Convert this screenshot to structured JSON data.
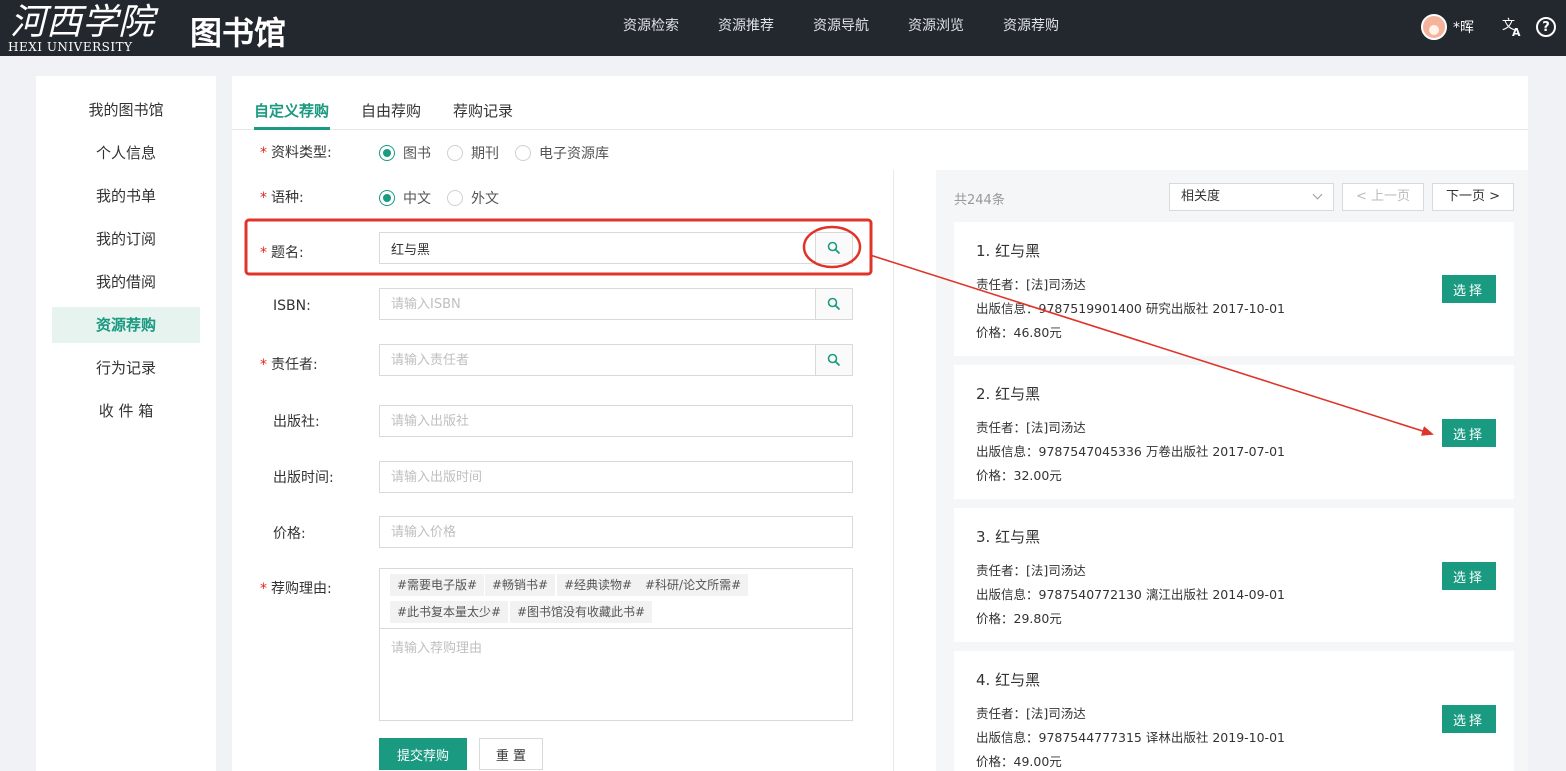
{
  "header": {
    "logo_calligraphy": "河西学院",
    "logo_en": "HEXI UNIVERSITY",
    "logo_lib": "图书馆",
    "nav": [
      "资源检索",
      "资源推荐",
      "资源导航",
      "资源浏览",
      "资源荐购"
    ],
    "username": "*晖",
    "lang_icon": "translate-icon",
    "help_icon": "help-icon"
  },
  "sidebar": {
    "items": [
      "我的图书馆",
      "个人信息",
      "我的书单",
      "我的订阅",
      "我的借阅",
      "资源荐购",
      "行为记录",
      "收 件 箱"
    ],
    "active": 5
  },
  "tabs": {
    "items": [
      "自定义荐购",
      "自由荐购",
      "荐购记录"
    ],
    "active": 0
  },
  "form": {
    "type": {
      "label": "资料类型:",
      "options": [
        "图书",
        "期刊",
        "电子资源库"
      ],
      "selected": 0
    },
    "language": {
      "label": "语种:",
      "options": [
        "中文",
        "外文"
      ],
      "selected": 0
    },
    "title": {
      "label": "题名:",
      "value": "红与黑"
    },
    "isbn": {
      "label": "ISBN:",
      "placeholder": "请输入ISBN"
    },
    "author": {
      "label": "责任者:",
      "placeholder": "请输入责任者"
    },
    "publisher": {
      "label": "出版社:",
      "placeholder": "请输入出版社"
    },
    "pubdate": {
      "label": "出版时间:",
      "placeholder": "请输入出版时间"
    },
    "price": {
      "label": "价格:",
      "placeholder": "请输入价格"
    },
    "reason": {
      "label": "荐购理由:",
      "tags": [
        "#需要电子版#",
        "#畅销书#",
        "#经典读物#",
        "#科研/论文所需#",
        "#此书复本量太少#",
        "#图书馆没有收藏此书#"
      ],
      "placeholder": "请输入荐购理由"
    },
    "submit_label": "提交荐购",
    "reset_label": "重 置"
  },
  "results": {
    "total": "共244条",
    "sort": "相关度",
    "prev": "上一页",
    "next": "下一页",
    "select_label": "选择",
    "items": [
      {
        "title": "1. 红与黑",
        "author": "责任者：[法]司汤达",
        "pub": "出版信息：9787519901400  研究出版社  2017-10-01",
        "price": "价格：46.80元"
      },
      {
        "title": "2. 红与黑",
        "author": "责任者：[法]司汤达",
        "pub": "出版信息：9787547045336  万卷出版社  2017-07-01",
        "price": "价格：32.00元"
      },
      {
        "title": "3. 红与黑",
        "author": "责任者：[法]司汤达",
        "pub": "出版信息：9787540772130  漓江出版社  2014-09-01",
        "price": "价格：29.80元"
      },
      {
        "title": "4. 红与黑",
        "author": "责任者：[法]司汤达",
        "pub": "出版信息：9787544777315  译林出版社  2019-10-01",
        "price": "价格：49.00元"
      }
    ]
  },
  "annotation": {
    "color": "#e0342a"
  },
  "colors": {
    "accent": "#1a9a80",
    "header": "#23272e",
    "required": "#e1251b"
  }
}
